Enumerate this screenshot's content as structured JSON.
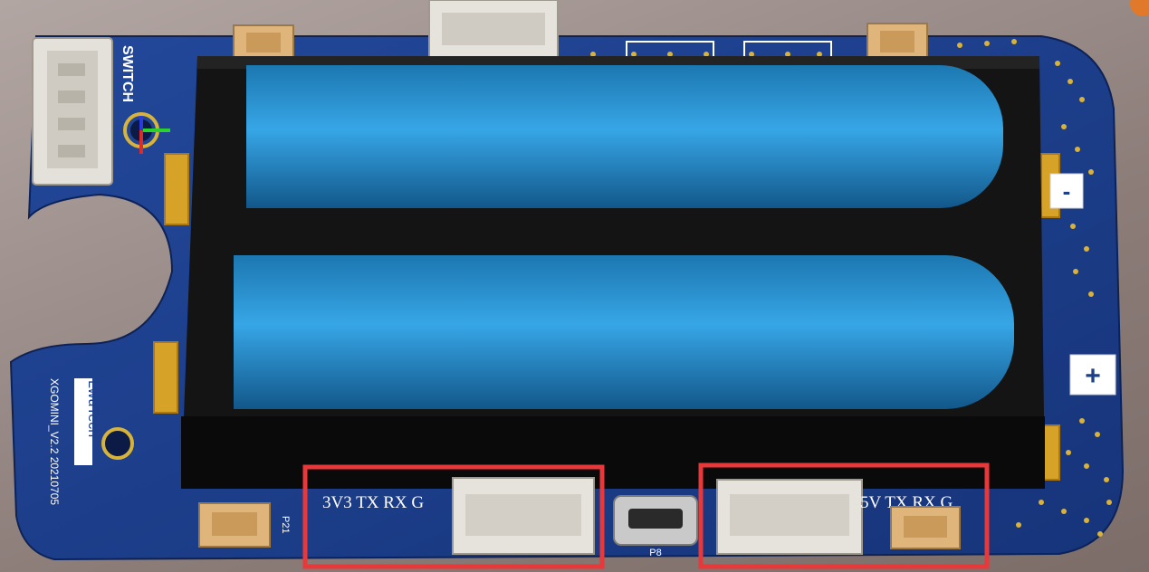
{
  "scene": {
    "board_labels": {
      "switch": "SWITCH",
      "brand": "LwuTech",
      "version": "XGOMINI_V2.2 20210705",
      "minus": "-",
      "plus": "+",
      "p21": "P21",
      "p8": "P8",
      "left_header_pins": "3V3  TX  RX  G",
      "right_header_pins": "5V  TX  RX  G"
    },
    "highlight_color": "#e8383a",
    "board_color": "#1c3f8c",
    "battery_color": "#2f9ad6"
  }
}
